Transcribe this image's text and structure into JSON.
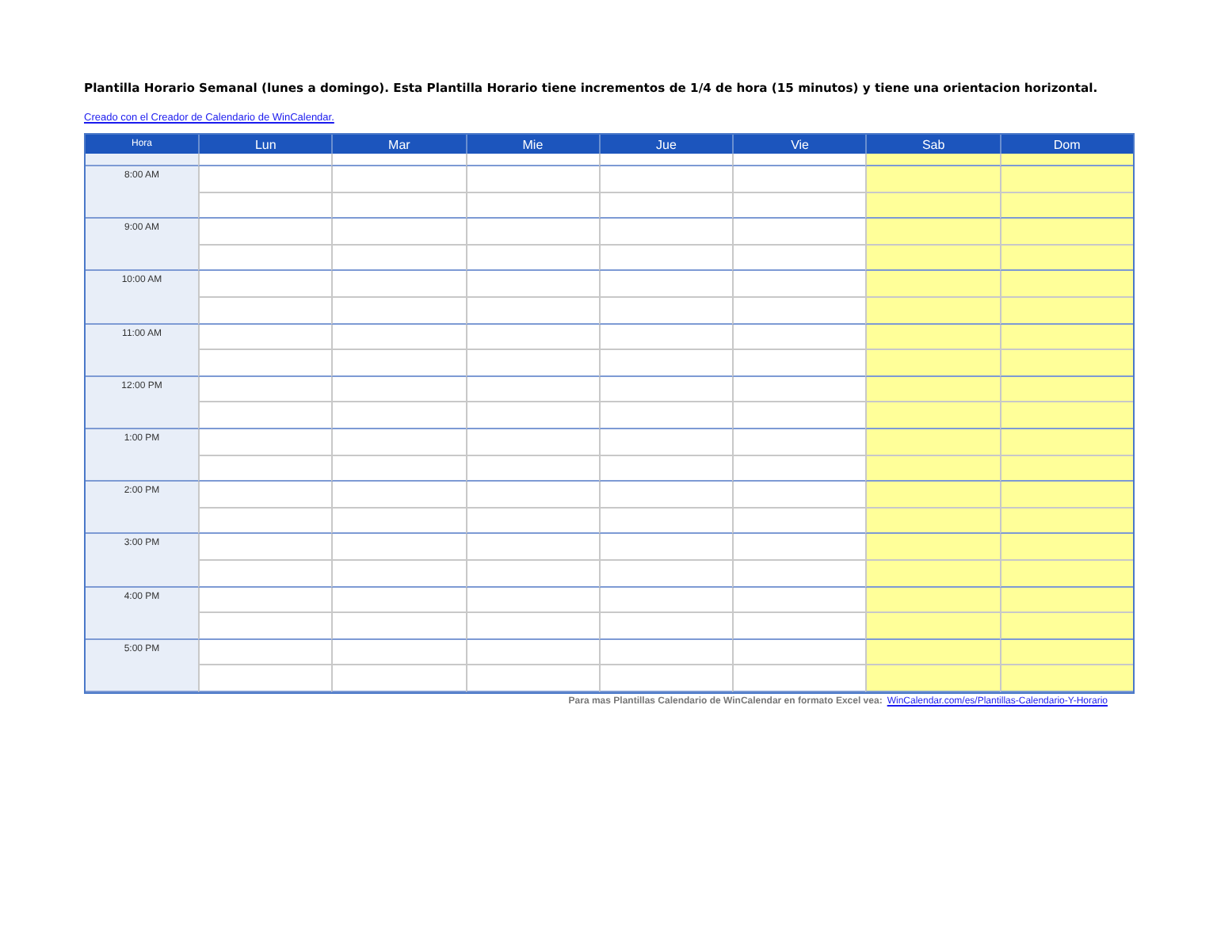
{
  "title": "Plantilla Horario Semanal (lunes a domingo). Esta Plantilla Horario tiene incrementos de 1/4 de hora (15 minutos) y tiene una orientacion horizontal.",
  "creator_link": "Creado con el Creador de Calendario de WinCalendar.",
  "table": {
    "hour_header": "Hora",
    "days": [
      {
        "label": "Lun",
        "weekend": false
      },
      {
        "label": "Mar",
        "weekend": false
      },
      {
        "label": "Mie",
        "weekend": false
      },
      {
        "label": "Jue",
        "weekend": false
      },
      {
        "label": "Vie",
        "weekend": false
      },
      {
        "label": "Sab",
        "weekend": true
      },
      {
        "label": "Dom",
        "weekend": true
      }
    ],
    "hours": [
      "8:00 AM",
      "9:00 AM",
      "10:00 AM",
      "11:00 AM",
      "12:00 PM",
      "1:00 PM",
      "2:00 PM",
      "3:00 PM",
      "4:00 PM",
      "5:00 PM"
    ]
  },
  "footer": {
    "text": "Para mas Plantillas Calendario de WinCalendar en formato Excel vea:",
    "link": "WinCalendar.com/es/Plantillas-Calendario-Y-Horario"
  }
}
